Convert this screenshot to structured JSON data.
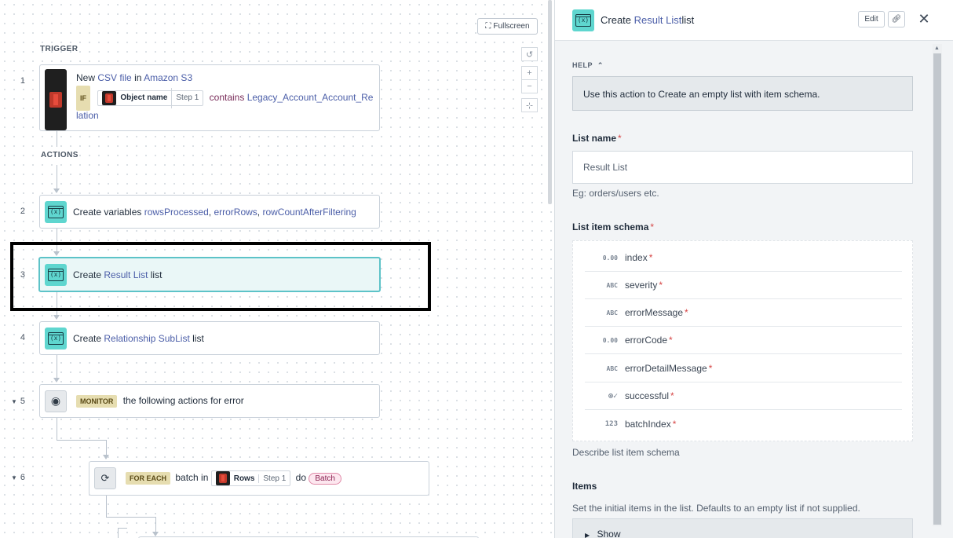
{
  "canvas": {
    "fullscreen_label": "Fullscreen",
    "zoom": {
      "reset_icon": "reset-icon",
      "plus": "+",
      "minus": "−",
      "fit_icon": "fit-icon"
    },
    "trigger_label": "TRIGGER",
    "actions_label": "ACTIONS",
    "steps": [
      {
        "num": "1",
        "text_new": "New",
        "link_file": "CSV file",
        "text_in": "in",
        "link_app": "Amazon S3",
        "if_label": "IF",
        "pill_name": "Object name",
        "pill_step": "Step 1",
        "contains_label": "contains",
        "value_line1": "Legacy_Account_Account_Re",
        "value_line2": "lation"
      },
      {
        "num": "2",
        "prefix": "Create variables",
        "link1": "rowsProcessed",
        "sep1": ",",
        "link2": "errorRows",
        "sep2": ",",
        "link3": "rowCountAfterFiltering"
      },
      {
        "num": "3",
        "prefix": "Create",
        "link": "Result List",
        "suffix": "list"
      },
      {
        "num": "4",
        "prefix": "Create",
        "link": "Relationship SubList",
        "suffix": "list"
      },
      {
        "num": "5",
        "badge": "MONITOR",
        "text": "the following actions for error"
      },
      {
        "num": "6",
        "badge": "FOR EACH",
        "text_batch_in": "batch in",
        "pill_name": "Rows",
        "pill_step": "Step 1",
        "text_do": "do",
        "tag": "Batch"
      }
    ]
  },
  "panel": {
    "title_prefix": "Create",
    "title_link": "Result List",
    "title_suffix": "list",
    "edit_label": "Edit",
    "help_label": "HELP",
    "help_text": "Use this action to Create an empty list with item schema.",
    "list_name_label": "List name",
    "list_name_value": "Result List",
    "list_name_hint": "Eg: orders/users etc.",
    "schema_label": "List item schema",
    "schema_fields": [
      {
        "type": "0.00",
        "name": "index"
      },
      {
        "type": "ABC",
        "name": "severity"
      },
      {
        "type": "ABC",
        "name": "errorMessage"
      },
      {
        "type": "0.00",
        "name": "errorCode"
      },
      {
        "type": "ABC",
        "name": "errorDetailMessage"
      },
      {
        "type": "⊗✓",
        "name": "successful"
      },
      {
        "type": "123",
        "name": "batchIndex"
      }
    ],
    "required_mark": "*",
    "schema_hint": "Describe list item schema",
    "items_label": "Items",
    "items_hint": "Set the initial items in the list. Defaults to an empty list if not supplied.",
    "show_label": "Show"
  },
  "colors": {
    "accent_teal": "#5fd6cf",
    "link": "#4b5ea8",
    "selected_border": "#5dc3c8",
    "required": "#d64545"
  }
}
